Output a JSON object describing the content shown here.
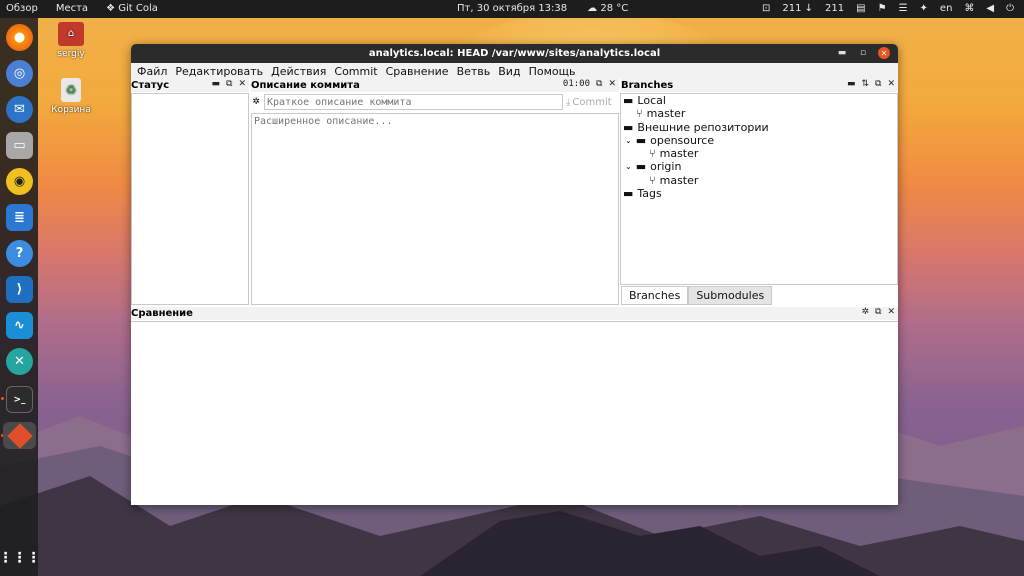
{
  "topbar": {
    "activities": "Обзор",
    "places": "Места",
    "app_name": "Git Cola",
    "datetime": "Пт, 30 октября  13:38",
    "weather": "28 °C",
    "net_up": "211",
    "net_down": "211",
    "lang": "en"
  },
  "desktop": {
    "home_label": "sergiy",
    "trash_label": "Корзина"
  },
  "window": {
    "title": "analytics.local: HEAD /var/www/sites/analytics.local"
  },
  "menu": {
    "items": [
      "Файл",
      "Редактировать",
      "Действия",
      "Commit",
      "Сравнение",
      "Ветвь",
      "Вид",
      "Помощь"
    ]
  },
  "status_panel": {
    "title": "Статус"
  },
  "commit_panel": {
    "title": "Описание коммита",
    "time": "01:00",
    "summary_placeholder": "Краткое описание коммита",
    "commit_button": "Commit",
    "description_placeholder": "Расширенное описание..."
  },
  "branches_panel": {
    "title": "Branches",
    "local_label": "Local",
    "local_branches": [
      "master"
    ],
    "remotes_label": "Внешние репозитории",
    "remote1_name": "opensource",
    "remote1_branch": "master",
    "remote2_name": "origin",
    "remote2_branch": "master",
    "tags_label": "Tags",
    "tab_branches": "Branches",
    "tab_submodules": "Submodules"
  },
  "diff_panel": {
    "title": "Сравнение"
  },
  "colors": {
    "accent": "#e95420",
    "titlebar": "#2b2b2b",
    "topbar": "#1d1d1d"
  }
}
